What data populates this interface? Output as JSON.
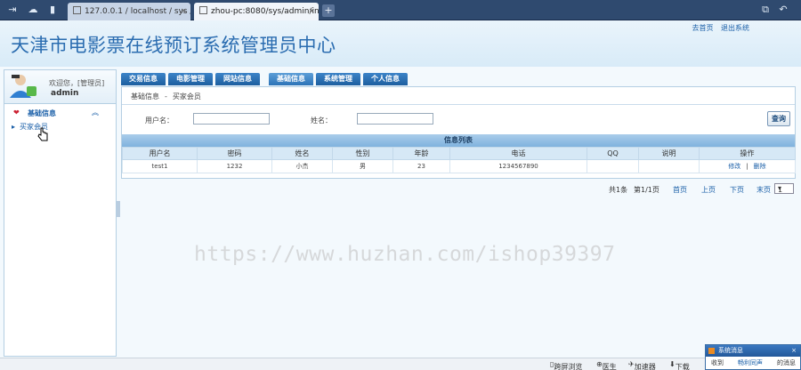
{
  "browser": {
    "tabs": [
      {
        "label": "127.0.0.1 / localhost / sys /",
        "active": false
      },
      {
        "label": "zhou-pc:8080/sys/admin/inc",
        "active": true
      }
    ],
    "new_tab": "+"
  },
  "header": {
    "title": "天津市电影票在线预订系统管理员中心",
    "links": [
      "去首页",
      "退出系统"
    ]
  },
  "sidebar": {
    "welcome": "欢迎您，[管理员]",
    "username": "admin",
    "menu_group": "基础信息",
    "menu_item": "买家会员"
  },
  "nav_tabs": [
    "交易信息",
    "电影管理",
    "网站信息",
    "基础信息",
    "系统管理",
    "个人信息"
  ],
  "active_tab": "基础信息",
  "breadcrumb": {
    "section": "基础信息",
    "separator": "-",
    "page": "买家会员"
  },
  "search": {
    "username_label": "用户名：",
    "username_value": "",
    "name_label": "姓名：",
    "name_value": "",
    "query_button": "查询"
  },
  "list": {
    "title": "信息列表",
    "columns": [
      "用户名",
      "密码",
      "姓名",
      "性别",
      "年龄",
      "电话",
      "QQ",
      "说明",
      "操作"
    ],
    "rows": [
      {
        "username": "test1",
        "password": "1232",
        "name": "小杰",
        "gender": "男",
        "age": "23",
        "phone": "1234567890",
        "qq": "",
        "note": "",
        "edit": "修改",
        "delete": "删除"
      }
    ]
  },
  "pager": {
    "total": "共1条",
    "page_info": "第1/1页",
    "first": "首页",
    "prev": "上页",
    "next": "下页",
    "last": "末页",
    "current": "1"
  },
  "watermark": "https://www.huzhan.com/ishop39397",
  "statusbar": {
    "items": [
      "跨屏浏览",
      "医生",
      "加速器",
      "下载"
    ]
  },
  "popup": {
    "title": "系统消息",
    "received": "收到",
    "source": "畅利同声",
    "message": "的消息"
  },
  "colors": {
    "accent": "#1a5fa8",
    "tab_blue": "#2c73b7",
    "title_blue": "#2a6cb0"
  }
}
